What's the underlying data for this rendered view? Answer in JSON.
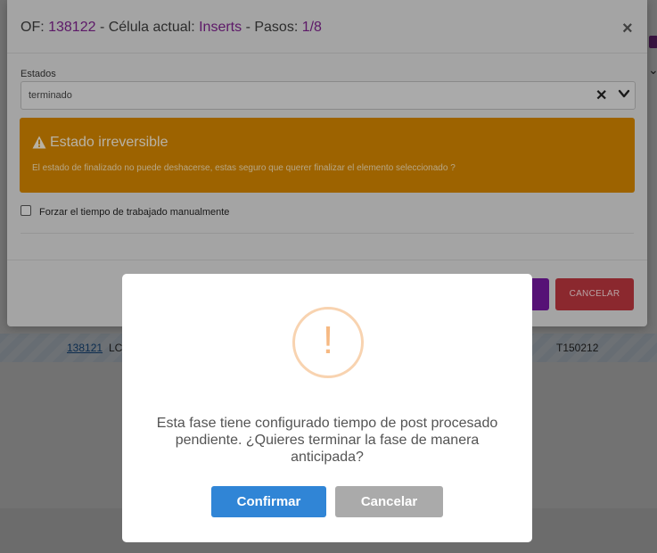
{
  "background": {
    "row": {
      "of_number": "138121",
      "lc_text": "LC",
      "code": "T150212"
    }
  },
  "modal": {
    "title": {
      "of_label": "OF: ",
      "of_value": "138122",
      "cell_label": " - Célula actual: ",
      "cell_value": "Inserts",
      "steps_label": " - Pasos: ",
      "steps_value": "1/8"
    },
    "close_icon": "×",
    "estados_label": "Estados",
    "estados_value": "terminado",
    "clear_icon": "✕",
    "warning": {
      "title": "Estado irreversible",
      "text": "El estado de finalizado no puede deshacerse, estas seguro que querer finalizar el elemento seleccionado ?"
    },
    "force_time_label": "Forzar el tiempo de trabajado manualmente",
    "force_time_checked": false,
    "cancel_label": "CANCELAR"
  },
  "dialog": {
    "icon": "!",
    "message": "Esta fase tiene configurado tiempo de post procesado pendiente. ¿Quieres terminar la fase de manera anticipada?",
    "confirm_label": "Confirmar",
    "cancel_label": "Cancelar"
  },
  "colors": {
    "accent": "#7b2189",
    "warning": "#cf8300",
    "confirm": "#3085d6",
    "cancel_grey": "#aaaaaa",
    "cancel_red": "#b7353d"
  }
}
